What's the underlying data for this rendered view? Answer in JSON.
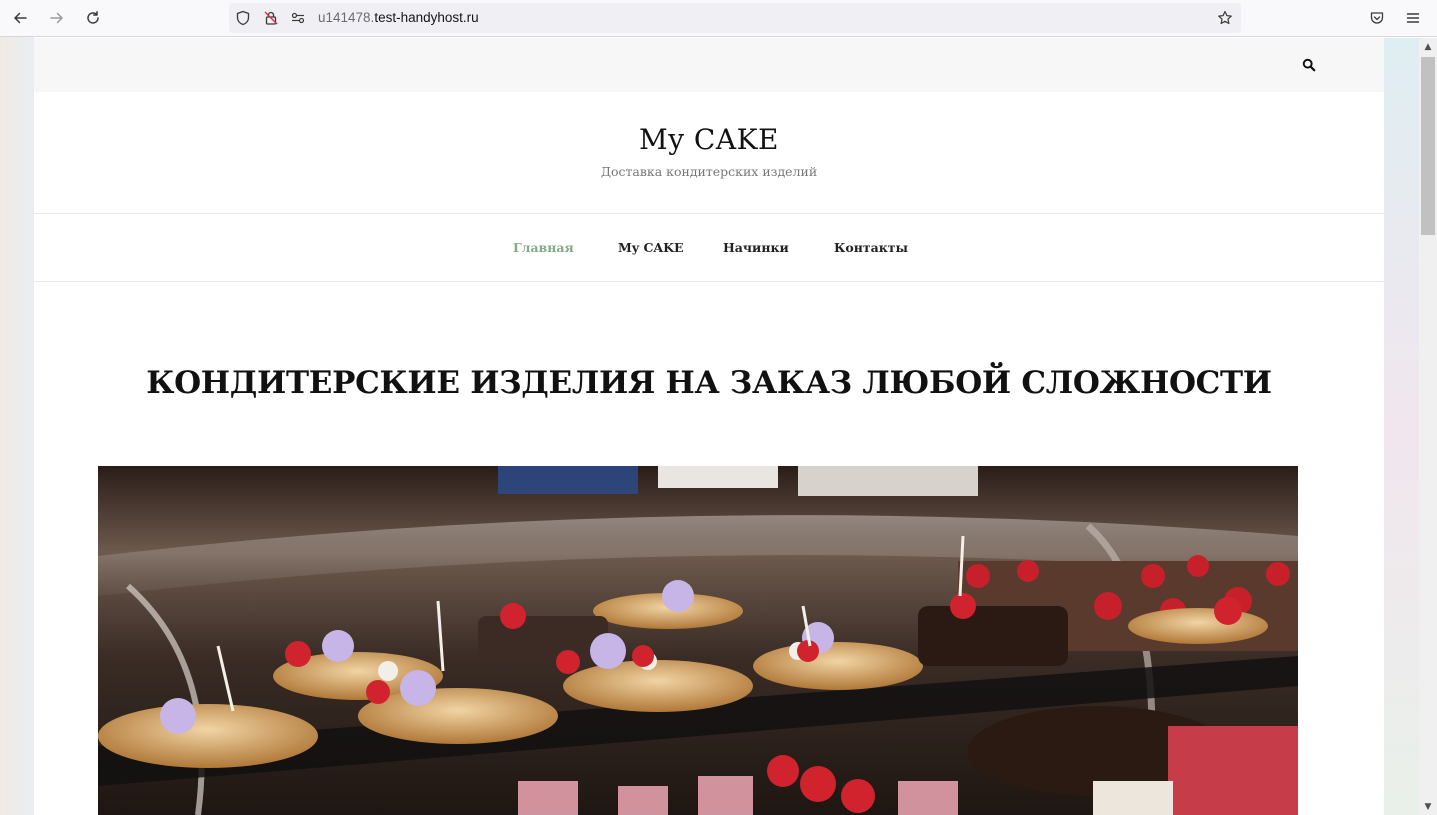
{
  "browser": {
    "url_host_prefix": "u141478.",
    "url_host_rest": "test-handyhost.ru",
    "icons": [
      "back-arrow-icon",
      "forward-arrow-icon",
      "reload-icon",
      "shield-icon",
      "insecure-lock-icon",
      "site-permissions-icon",
      "bookmark-star-icon",
      "pocket-icon",
      "menu-icon"
    ]
  },
  "site": {
    "title": "My CAKE",
    "description": "Доставка кондитерских изделий",
    "search_icon": "search-icon"
  },
  "nav": {
    "items": [
      {
        "label": "Главная",
        "active": true
      },
      {
        "label": "My CAKE",
        "active": false
      },
      {
        "label": "Начинки",
        "active": false
      },
      {
        "label": "Контакты",
        "active": false
      }
    ]
  },
  "main": {
    "heading": "КОНДИТЕРСКИЕ ИЗДЕЛИЯ НА ЗАКАЗ ЛЮБОЙ СЛОЖНОСТИ",
    "hero_image": "pastry-display-case-photo"
  },
  "colors": {
    "accent_green": "#7fae85",
    "topbar_bg": "#f7f7f7",
    "text_dark": "#111111"
  }
}
